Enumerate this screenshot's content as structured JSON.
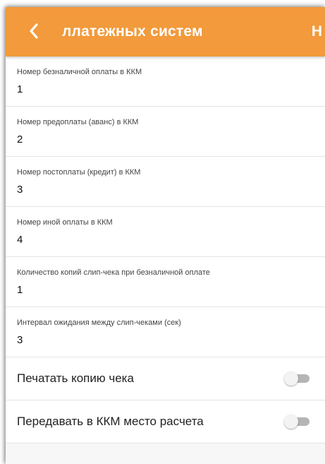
{
  "toolbar": {
    "back_icon": "chevron-left-icon",
    "title": "ллатежных систем",
    "action": "Н",
    "background_color": "#f29a3c"
  },
  "fields": [
    {
      "label": "Номер безналичной оплаты в ККМ",
      "value": "1"
    },
    {
      "label": "Номер предоплаты (аванс) в ККМ",
      "value": "2"
    },
    {
      "label": "Номер постоплаты (кредит) в ККМ",
      "value": "3"
    },
    {
      "label": "Номер иной оплаты в ККМ",
      "value": "4"
    },
    {
      "label": "Количество копий слип-чека при безналичной оплате",
      "value": "1"
    },
    {
      "label": "Интервал ожидания между слип-чеками (сек)",
      "value": "3"
    }
  ],
  "toggles": [
    {
      "label": "Печатать копию чека",
      "checked": false
    },
    {
      "label": "Передавать в ККМ место расчета",
      "checked": false
    }
  ]
}
